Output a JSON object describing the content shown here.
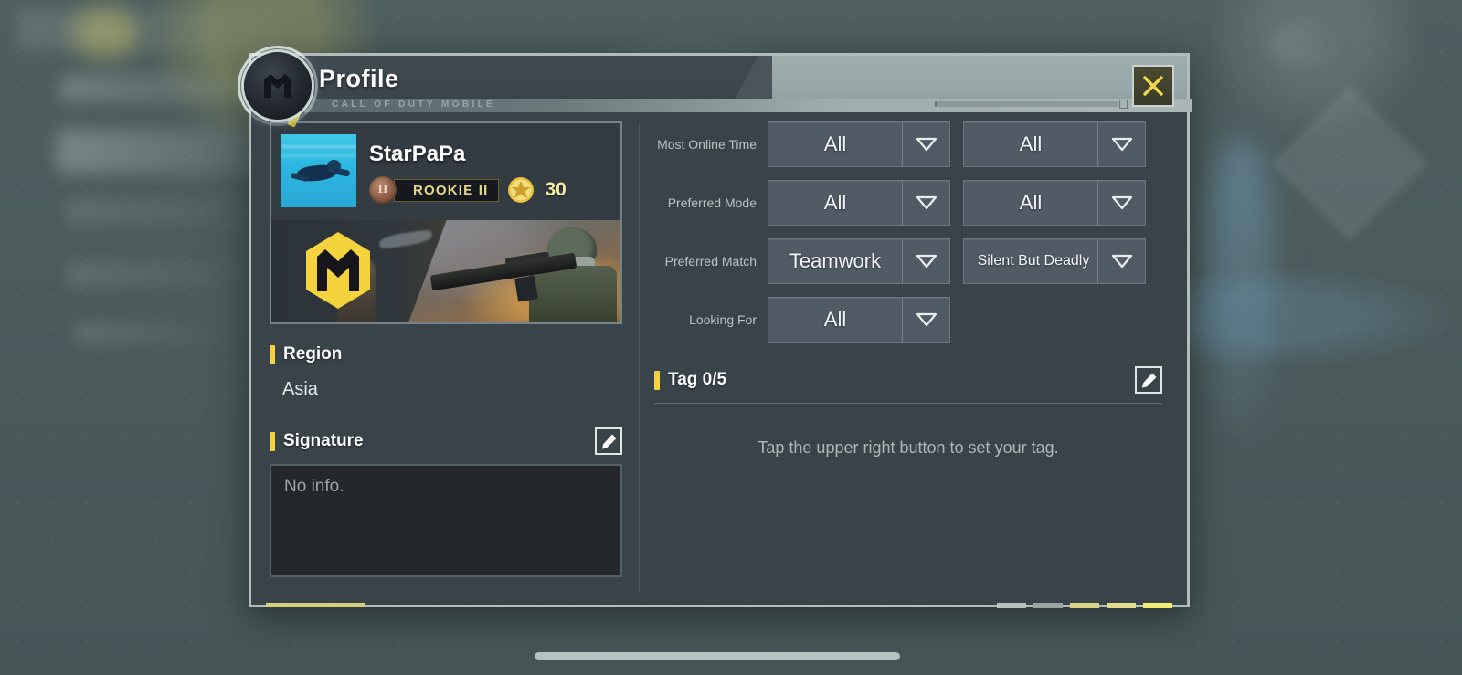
{
  "header": {
    "title": "Profile",
    "subtitle": "CALL OF DUTY MOBILE",
    "emblem_icon": "codm-emblem-icon",
    "close_icon": "close-icon"
  },
  "player": {
    "name": "StarPaPa",
    "rank_medal_numeral": "II",
    "rank_label": "ROOKIE II",
    "level": "30",
    "star_icon": "star-badge-icon",
    "avatar_icon": "underwater-swimmer-avatar",
    "banner_logo_icon": "codm-hex-logo-icon"
  },
  "left": {
    "region_label": "Region",
    "region_value": "Asia",
    "signature_label": "Signature",
    "signature_text": "No info.",
    "signature_edit_icon": "edit-pencil-icon"
  },
  "filters": [
    {
      "label": "Most Online Time",
      "primary": "All",
      "secondary": "All",
      "has_secondary": true
    },
    {
      "label": "Preferred Mode",
      "primary": "All",
      "secondary": "All",
      "has_secondary": true
    },
    {
      "label": "Preferred Match",
      "primary": "Teamwork",
      "secondary": "Silent But Deadly",
      "has_secondary": true
    },
    {
      "label": "Looking For",
      "primary": "All",
      "secondary": "",
      "has_secondary": false
    }
  ],
  "tag": {
    "label": "Tag 0/5",
    "edit_icon": "edit-pencil-icon",
    "hint": "Tap the upper right button to set your tag."
  },
  "colors": {
    "accent_yellow": "#f4d33c",
    "panel_bg": "#39434a",
    "select_bg": "#515b66",
    "border_light": "#b2bcbb",
    "close_yellow": "#f0d84a"
  },
  "decor": {
    "bottom_dashes": [
      "#b9c2c0",
      "#9aa4a3",
      "#d9d385",
      "#e2dc8e",
      "#f2ec74"
    ]
  }
}
